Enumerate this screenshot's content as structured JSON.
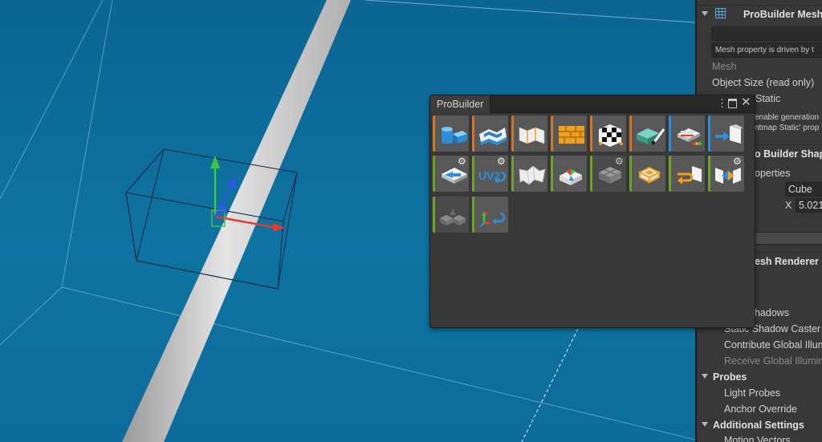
{
  "scene": {
    "background": "#0d6c9b",
    "stripe_color": "#d9d9d9",
    "gizmo": {
      "x_axis_color": "#e63b2e",
      "y_axis_color": "#3ec83e",
      "z_axis_color": "#2f57e6"
    }
  },
  "probuilder_window": {
    "title": "ProBuilder",
    "menu_icon": "kebab-menu-icon",
    "maximize_icon": "maximize-icon",
    "close_icon": "close-icon",
    "tools": [
      {
        "name": "new-shape-tool-icon",
        "category": "orange"
      },
      {
        "name": "poly-shape-tool-icon",
        "category": "orange"
      },
      {
        "name": "smoothing-tool-icon",
        "category": "orange"
      },
      {
        "name": "material-editor-tool-icon",
        "category": "orange"
      },
      {
        "name": "uv-editor-tool-icon",
        "category": "orange"
      },
      {
        "name": "vertex-colors-tool-icon",
        "category": "orange"
      },
      {
        "name": "new-poly-shape-tool-icon",
        "category": "blue"
      },
      {
        "name": "export-tool-icon",
        "category": "blue"
      },
      {
        "name": "center-pivot-tool-icon",
        "category": "green",
        "has_options": true
      },
      {
        "name": "generate-uv2-tool-icon",
        "category": "green",
        "has_options": true,
        "label": "UV2"
      },
      {
        "name": "flip-normals-tool-icon",
        "category": "green"
      },
      {
        "name": "triangulate-tool-icon",
        "category": "green"
      },
      {
        "name": "subdivide-tool-icon",
        "category": "green",
        "has_options": true
      },
      {
        "name": "conform-normals-tool-icon",
        "category": "green"
      },
      {
        "name": "freeze-transform-tool-icon",
        "category": "green"
      },
      {
        "name": "merge-objects-tool-icon",
        "category": "green",
        "has_options": true
      },
      {
        "name": "mirror-objects-tool-icon",
        "category": "green"
      },
      {
        "name": "pivot-to-vertex-tool-icon",
        "category": "green"
      }
    ]
  },
  "inspector": {
    "component_title": "ProBuilder Mesh",
    "mesh_notice": "Mesh property is driven by t",
    "mesh_label": "Mesh",
    "object_size_label": "Object Size (read only)",
    "static_label": "Static",
    "lightmap_note_1": "enable generation",
    "lightmap_note_2": "ntmap Static' prop",
    "shape_section": "o Builder Shape",
    "properties_label": "operties",
    "shape_value": "Cube",
    "x_label": "X",
    "x_value": "5.021",
    "mesh_renderer_title": "esh Renderer",
    "cast_shadows_label": "hadows",
    "static_shadow_caster": "Static Shadow Caster",
    "contribute_gi": "Contribute Global Illum",
    "receive_gi": "Receive Global Illumin",
    "probes_section": "Probes",
    "light_probes": "Light Probes",
    "anchor_override": "Anchor Override",
    "additional_settings": "Additional Settings",
    "motion_vectors": "Motion Vectors"
  }
}
